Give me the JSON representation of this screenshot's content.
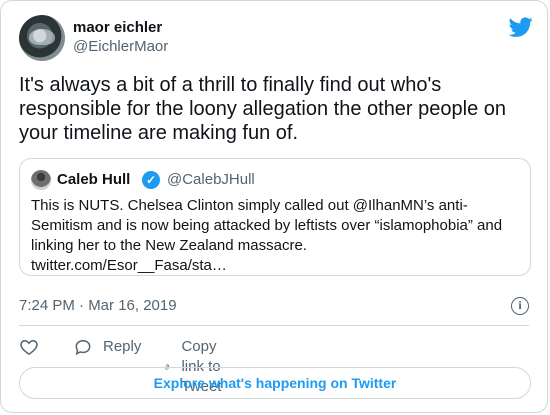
{
  "author": {
    "name": "maor eichler",
    "handle": "@EichlerMaor"
  },
  "tweet": {
    "text": "It's always a bit of a thrill to finally find out who's responsible for the loony allegation the other people on your timeline are making fun of.",
    "timestamp": "7:24 PM · Mar 16, 2019"
  },
  "quoted": {
    "name": "Caleb Hull",
    "verified": true,
    "handle": "@CalebJHull",
    "text": "This is NUTS. Chelsea Clinton simply called out @IlhanMN’s anti-Semitism and is now being attacked by leftists over “islamophobia” and linking her to the New Zealand massacre.",
    "link": "twitter.com/Esor__Fasa/sta…"
  },
  "actions": {
    "reply": "Reply",
    "copy_link": "Copy link to Tweet"
  },
  "footer": {
    "explore": "Explore what's happening on Twitter"
  },
  "colors": {
    "accent": "#1d9bf0",
    "muted": "#536471",
    "border": "#cfd9de"
  }
}
